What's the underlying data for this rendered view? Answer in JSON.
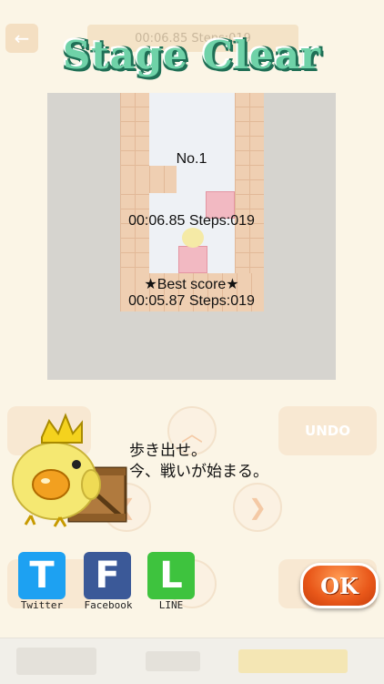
{
  "screen": {
    "title": "Stage Clear",
    "background_timer": "00:06.85  Steps:019",
    "back_icon": "back-arrow-icon"
  },
  "result": {
    "stage": "No.1",
    "current": "00:06.85   Steps:019",
    "best_label": "★Best score★",
    "best": "00:05.87   Steps:019"
  },
  "controls": {
    "undo_label": "UNDO",
    "up_icon": "chevron-up-icon",
    "right_icon": "chevron-right-icon",
    "left_icon": "chevron-left-icon"
  },
  "message": {
    "line1": "歩き出せ。",
    "line2": "今、戦いが始まる。"
  },
  "share": {
    "twitter": {
      "letter": "T",
      "label": "Twitter",
      "color": "#1da1f2"
    },
    "facebook": {
      "letter": "F",
      "label": "Facebook",
      "color": "#3b5998"
    },
    "line": {
      "letter": "L",
      "label": "LINE",
      "color": "#3ec33e"
    }
  },
  "ok_label": "OK",
  "colors": {
    "title_fill": "#6fd2a8",
    "title_outline": "#1f6f55",
    "ok_orange": "#e9581a"
  }
}
